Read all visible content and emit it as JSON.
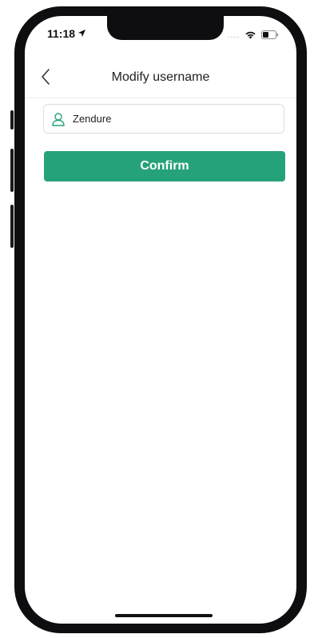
{
  "status_bar": {
    "time": "11:18",
    "location_icon": "location-arrow-icon",
    "signal_dots": "....",
    "wifi_icon": "wifi-icon",
    "battery_icon": "battery-icon"
  },
  "nav": {
    "title": "Modify username",
    "back_icon": "chevron-left-icon"
  },
  "username_input": {
    "value": "Zendure",
    "icon": "user-icon"
  },
  "confirm_button": {
    "label": "Confirm"
  },
  "colors": {
    "accent": "#26a27a",
    "icon_green": "#26a27a"
  }
}
